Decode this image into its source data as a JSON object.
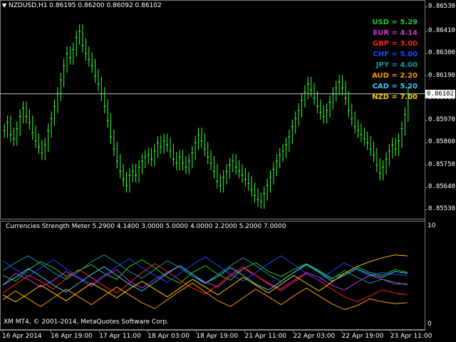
{
  "window": {
    "symbol_line": "NZDUSD,H1  0.86195 0.86200 0.86092 0.86102"
  },
  "price_panel": {
    "current_price_label": "0.86102",
    "price_ticks": [
      "0.86530",
      "0.86410",
      "0.86300",
      "0.86190",
      "0.86080",
      "0.85970",
      "0.85860",
      "0.85750",
      "0.85640",
      "0.85530"
    ],
    "current_price": 0.86102
  },
  "legend": [
    {
      "label": "USD = 5.29",
      "color": "#22cc22"
    },
    {
      "label": "EUR = 4.14",
      "color": "#cc33cc"
    },
    {
      "label": "GBP = 3.00",
      "color": "#ff2020"
    },
    {
      "label": "CHF = 5.00",
      "color": "#2244ff"
    },
    {
      "label": "JPY = 4.00",
      "color": "#139a9a"
    },
    {
      "label": "AUD = 2.20",
      "color": "#ff9900"
    },
    {
      "label": "CAD = 5.20",
      "color": "#33ccff"
    },
    {
      "label": "NZD = 7.00",
      "color": "#ffcc00"
    }
  ],
  "indicator_panel": {
    "title": "Currencies Strength Meter 5.2900 4.1400 3.0000 5.0000 4.0000 2.2000 5.2000 7.0000",
    "scale_top": "10",
    "scale_bottom": "0",
    "copyright": "XM MT4, © 2001-2014, MetaQuotes Software Corp."
  },
  "time_axis": [
    "16 Apr 2014",
    "16 Apr 19:00",
    "17 Apr 11:00",
    "18 Apr 03:00",
    "18 Apr 19:00",
    "21 Apr 11:00",
    "22 Apr 03:00",
    "22 Apr 19:00",
    "23 Apr 11:00"
  ],
  "chart_data": [
    {
      "type": "line",
      "title": "NZDUSD,H1",
      "ylim": [
        0.855,
        0.8655
      ],
      "series": [
        {
          "name": "NZDUSD",
          "values": [
            0.8592,
            0.8596,
            0.859,
            0.8588,
            0.8593,
            0.8599,
            0.8603,
            0.8599,
            0.8596,
            0.8591,
            0.8587,
            0.8584,
            0.8581,
            0.8585,
            0.8592,
            0.8598,
            0.8604,
            0.861,
            0.8617,
            0.8624,
            0.863,
            0.8628,
            0.8632,
            0.8638,
            0.8641,
            0.8634,
            0.863,
            0.8627,
            0.8624,
            0.8619,
            0.8615,
            0.861,
            0.8604,
            0.8597,
            0.8589,
            0.8583,
            0.8577,
            0.8572,
            0.8568,
            0.8565,
            0.857,
            0.8572,
            0.857,
            0.8574,
            0.8577,
            0.8579,
            0.858,
            0.8578,
            0.8582,
            0.8586,
            0.8584,
            0.8587,
            0.8585,
            0.8582,
            0.8578,
            0.8576,
            0.8579,
            0.8576,
            0.8574,
            0.8577,
            0.8581,
            0.8586,
            0.859,
            0.8587,
            0.8583,
            0.8579,
            0.8576,
            0.8572,
            0.8567,
            0.8565,
            0.8569,
            0.8572,
            0.8575,
            0.8577,
            0.8574,
            0.8572,
            0.857,
            0.8568,
            0.8566,
            0.8563,
            0.856,
            0.8558,
            0.8557,
            0.8561,
            0.8565,
            0.8569,
            0.8573,
            0.8577,
            0.858,
            0.8582,
            0.8585,
            0.8589,
            0.8594,
            0.8598,
            0.8602,
            0.8607,
            0.8611,
            0.8615,
            0.8612,
            0.8608,
            0.8604,
            0.8601,
            0.8599,
            0.8602,
            0.8606,
            0.861,
            0.8613,
            0.8616,
            0.8613,
            0.8608,
            0.8602,
            0.8598,
            0.8594,
            0.8592,
            0.859,
            0.8588,
            0.8586,
            0.8583,
            0.858,
            0.8575,
            0.8571,
            0.8574,
            0.8578,
            0.8582,
            0.8585,
            0.8583,
            0.8587,
            0.8593,
            0.86,
            0.861
          ]
        }
      ]
    },
    {
      "type": "line",
      "title": "Currencies Strength Meter",
      "ylim": [
        0,
        10
      ],
      "series": [
        {
          "name": "USD",
          "values": [
            5.0,
            4.4,
            5.6,
            6.4,
            5.8,
            4.9,
            5.5,
            6.1,
            5.2,
            4.6,
            5.9,
            6.6,
            5.8,
            4.8,
            4.2,
            5.3,
            6.0,
            5.1,
            4.5,
            5.7,
            6.3,
            5.4,
            4.9,
            5.6,
            6.2,
            5.5,
            4.7,
            5.2,
            5.9,
            5.3,
            5.0,
            5.6,
            5.29
          ]
        },
        {
          "name": "EUR",
          "values": [
            4.0,
            5.2,
            4.6,
            3.8,
            4.5,
            5.4,
            4.7,
            3.9,
            4.9,
            5.6,
            4.4,
            3.7,
            4.6,
            5.3,
            6.0,
            5.1,
            4.3,
            3.8,
            4.9,
            5.7,
            5.0,
            4.2,
            3.6,
            4.5,
            5.3,
            4.8,
            4.0,
            3.5,
            4.3,
            5.0,
            4.6,
            4.1,
            4.14
          ]
        },
        {
          "name": "GBP",
          "values": [
            3.2,
            4.1,
            5.0,
            4.4,
            3.6,
            4.7,
            5.6,
            4.8,
            3.9,
            3.2,
            4.2,
            5.3,
            6.2,
            5.4,
            4.5,
            3.7,
            3.1,
            4.0,
            5.1,
            5.9,
            5.0,
            4.1,
            3.4,
            4.3,
            5.2,
            4.5,
            3.6,
            2.8,
            2.3,
            2.9,
            3.5,
            3.2,
            3.0
          ]
        },
        {
          "name": "CHF",
          "values": [
            6.5,
            5.6,
            4.9,
            5.8,
            6.6,
            5.7,
            4.8,
            4.1,
            5.0,
            5.9,
            6.7,
            5.8,
            5.0,
            4.3,
            5.2,
            6.1,
            6.9,
            6.0,
            5.1,
            4.4,
            5.3,
            6.2,
            7.0,
            6.1,
            5.2,
            4.5,
            5.4,
            6.3,
            5.6,
            4.9,
            5.3,
            5.1,
            5.0
          ]
        },
        {
          "name": "JPY",
          "values": [
            5.5,
            6.3,
            7.0,
            6.2,
            5.3,
            4.6,
            5.4,
            6.4,
            7.1,
            6.3,
            5.4,
            4.7,
            5.6,
            6.5,
            5.8,
            4.9,
            4.2,
            5.1,
            6.0,
            6.8,
            6.0,
            5.1,
            4.4,
            5.3,
            6.2,
            5.4,
            4.6,
            5.5,
            4.8,
            4.2,
            4.6,
            4.3,
            4.0
          ]
        },
        {
          "name": "AUD",
          "values": [
            2.5,
            3.4,
            2.6,
            1.8,
            2.7,
            3.6,
            2.8,
            2.0,
            2.9,
            3.8,
            3.0,
            2.2,
            1.6,
            2.5,
            3.4,
            4.2,
            3.3,
            2.4,
            1.8,
            2.7,
            3.6,
            2.8,
            2.0,
            2.9,
            3.7,
            2.9,
            2.1,
            1.5,
            1.9,
            2.6,
            2.3,
            2.1,
            2.2
          ]
        },
        {
          "name": "CAD",
          "values": [
            4.0,
            4.8,
            5.7,
            4.9,
            4.0,
            3.3,
            4.2,
            5.1,
            5.9,
            5.0,
            4.1,
            3.4,
            4.3,
            5.2,
            6.0,
            5.1,
            4.2,
            4.9,
            5.8,
            5.0,
            4.1,
            3.5,
            4.4,
            5.3,
            6.1,
            5.3,
            4.4,
            5.0,
            5.7,
            5.1,
            4.8,
            5.4,
            5.2
          ]
        },
        {
          "name": "NZD",
          "values": [
            3.0,
            2.3,
            3.1,
            4.0,
            3.2,
            2.4,
            3.3,
            4.2,
            3.5,
            2.7,
            3.6,
            4.4,
            3.6,
            2.8,
            3.7,
            4.6,
            3.8,
            3.0,
            3.9,
            4.8,
            4.0,
            3.2,
            4.1,
            5.0,
            4.2,
            3.4,
            4.3,
            5.2,
            5.9,
            6.4,
            6.8,
            7.1,
            7.0
          ]
        }
      ]
    }
  ]
}
